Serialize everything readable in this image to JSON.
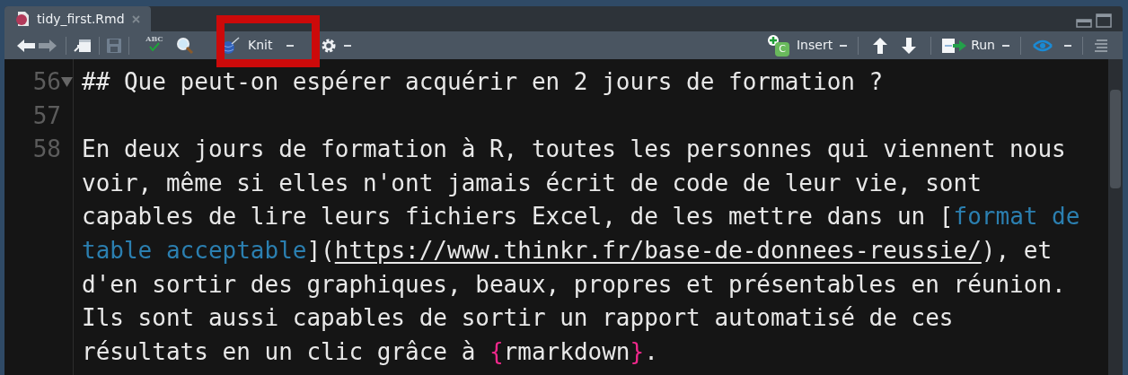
{
  "tab": {
    "title": "tidy_first.Rmd",
    "selected": true
  },
  "toolbar_left": [
    {
      "kind": "back"
    },
    {
      "kind": "forward"
    },
    {
      "kind": "sep"
    },
    {
      "kind": "goto"
    },
    {
      "kind": "sep"
    },
    {
      "kind": "save",
      "disabled": true
    },
    {
      "kind": "sep"
    },
    {
      "kind": "spell",
      "text": "ABC"
    },
    {
      "kind": "search"
    },
    {
      "kind": "knit",
      "label": "Knit"
    },
    {
      "kind": "gear"
    }
  ],
  "toolbar_right": [
    {
      "kind": "insert",
      "label": "Insert",
      "icon_text": "C"
    },
    {
      "kind": "sep"
    },
    {
      "kind": "up"
    },
    {
      "kind": "down"
    },
    {
      "kind": "sep"
    },
    {
      "kind": "run",
      "label": "Run"
    },
    {
      "kind": "sep"
    },
    {
      "kind": "rerun"
    },
    {
      "kind": "sep"
    },
    {
      "kind": "outline"
    }
  ],
  "highlight": {
    "shown": true
  },
  "lines": [
    {
      "number": "56",
      "foldable": true,
      "segments": [
        {
          "kind": "plain",
          "text": "## Que peut-on espérer acquérir en 2 jours de formation ?"
        }
      ]
    },
    {
      "number": "57"
    },
    {
      "number": "58",
      "segments": [
        {
          "kind": "plain",
          "text": "En deux jours de formation à R, toutes les personnes qui viennent nous"
        }
      ]
    },
    {
      "segments": [
        {
          "kind": "plain",
          "text": "voir, même si elles n'ont jamais écrit de code de leur vie, sont"
        }
      ]
    },
    {
      "segments": [
        {
          "kind": "plain",
          "text": "capables de lire leurs fichiers Excel, de les mettre dans un ["
        },
        {
          "kind": "link",
          "text": "format de"
        }
      ]
    },
    {
      "segments": [
        {
          "kind": "link",
          "text": "table acceptable"
        },
        {
          "kind": "plain",
          "text": "]("
        },
        {
          "kind": "url",
          "text": "https://www.thinkr.fr/base-de-donnees-reussie/"
        },
        {
          "kind": "plain",
          "text": "), et"
        }
      ]
    },
    {
      "segments": [
        {
          "kind": "plain",
          "text": "d'en sortir des graphiques, beaux, propres et présentables en réunion."
        }
      ]
    },
    {
      "segments": [
        {
          "kind": "plain",
          "text": "Ils sont aussi capables de sortir un rapport automatisé de ces"
        }
      ]
    },
    {
      "segments": [
        {
          "kind": "plain",
          "text": "résultats en un clic grâce à "
        },
        {
          "kind": "brace",
          "text": "{"
        },
        {
          "kind": "plain",
          "text": "rmarkdown"
        },
        {
          "kind": "brace",
          "text": "}"
        },
        {
          "kind": "plain",
          "text": "."
        }
      ]
    }
  ]
}
